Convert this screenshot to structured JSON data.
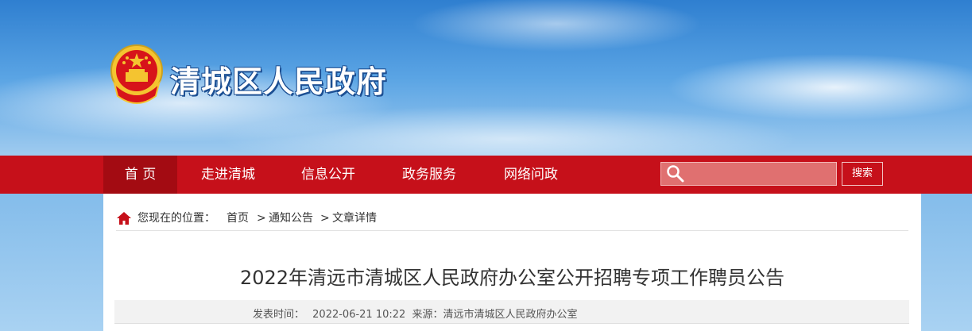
{
  "site": {
    "title": "清城区人民政府"
  },
  "nav": {
    "items": [
      {
        "label": "首 页",
        "active": true
      },
      {
        "label": "走进清城",
        "active": false
      },
      {
        "label": "信息公开",
        "active": false
      },
      {
        "label": "政务服务",
        "active": false
      },
      {
        "label": "网络问政",
        "active": false
      }
    ],
    "search": {
      "value": "",
      "placeholder": "",
      "button_label": "搜索"
    }
  },
  "breadcrumb": {
    "prefix": "您现在的位置：",
    "items": [
      "首页",
      "通知公告",
      "文章详情"
    ],
    "separator": ">"
  },
  "article": {
    "title": "2022年清远市清城区人民政府办公室公开招聘专项工作聘员公告",
    "meta": {
      "publish_label": "发表时间：",
      "publish_time": "2022-06-21 10:22",
      "source_label": "来源：",
      "source": "清远市清城区人民政府办公室"
    }
  },
  "colors": {
    "nav_red": "#c6101a",
    "nav_active": "#a30b12",
    "title_text": "#333333"
  },
  "icons": [
    "national-emblem-icon",
    "search-icon",
    "home-icon"
  ]
}
